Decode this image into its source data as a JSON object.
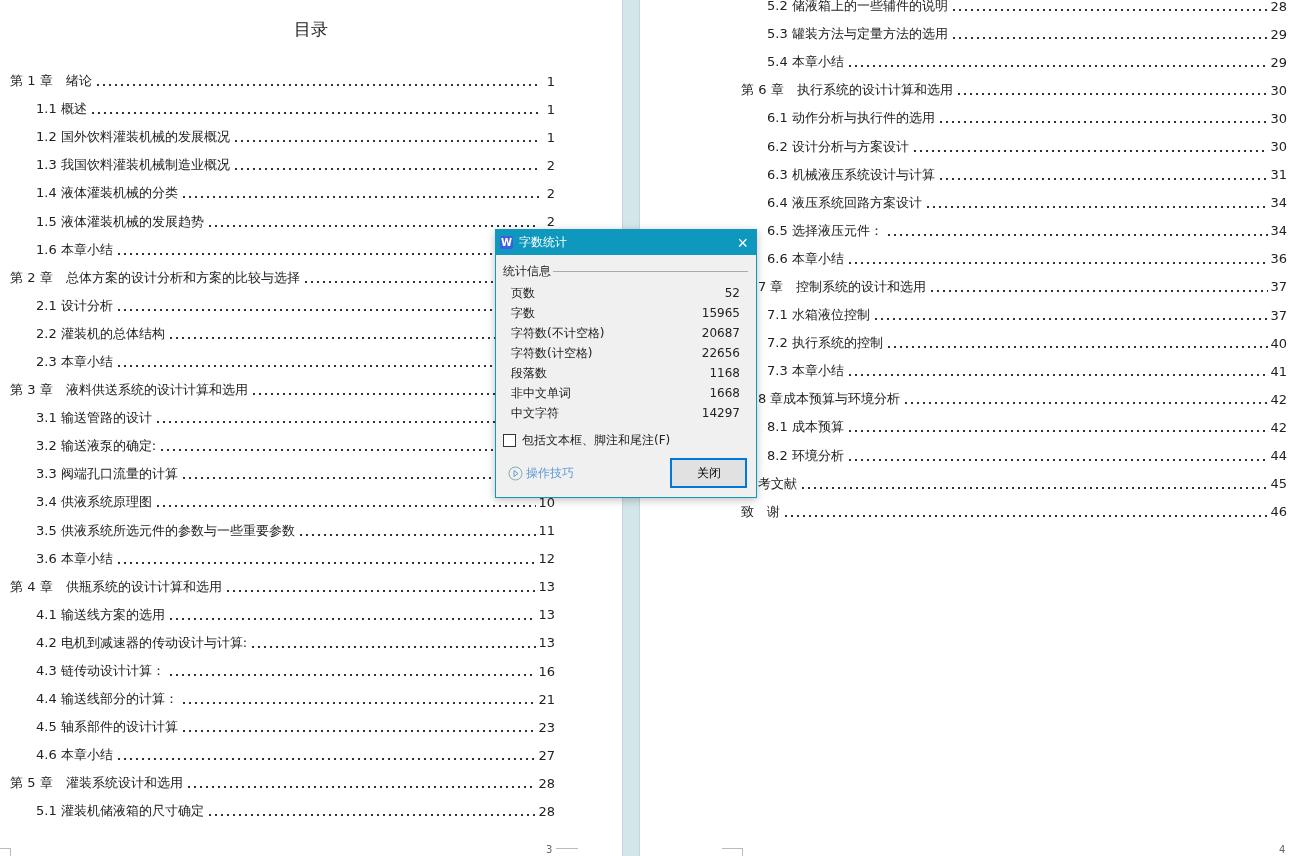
{
  "left_page": {
    "title": "目录",
    "entries": [
      {
        "kind": "chapter",
        "text": "第 1 章　绪论",
        "page": "1"
      },
      {
        "kind": "section",
        "text": "1.1 概述",
        "page": "1"
      },
      {
        "kind": "section",
        "text": "1.2 国外饮料灌装机械的发展概况",
        "page": "1"
      },
      {
        "kind": "section",
        "text": "1.3 我国饮料灌装机械制造业概况",
        "page": "2"
      },
      {
        "kind": "section",
        "text": "1.4 液体灌装机械的分类",
        "page": "2"
      },
      {
        "kind": "section",
        "text": "1.5 液体灌装机械的发展趋势",
        "page": "2"
      },
      {
        "kind": "section",
        "text": "1.6 本章小结"
      },
      {
        "kind": "chapter",
        "text": "第 2 章　总体方案的设计分析和方案的比较与选择"
      },
      {
        "kind": "section",
        "text": "2.1 设计分析"
      },
      {
        "kind": "section",
        "text": "2.2 灌装机的总体结构"
      },
      {
        "kind": "section",
        "text": "2.3 本章小结"
      },
      {
        "kind": "chapter",
        "text": "第 3 章　液料供送系统的设计计算和选用"
      },
      {
        "kind": "section",
        "text": "3.1 输送管路的设计"
      },
      {
        "kind": "section",
        "text": "3.2 输送液泵的确定:"
      },
      {
        "kind": "section",
        "text": "3.3 阀端孔口流量的计算"
      },
      {
        "kind": "section",
        "text": "3.4 供液系统原理图",
        "page": "10"
      },
      {
        "kind": "section",
        "text": "3.5 供液系统所选元件的参数与一些重要参数",
        "page": "11"
      },
      {
        "kind": "section",
        "text": "3.6 本章小结",
        "page": "12"
      },
      {
        "kind": "chapter",
        "text": "第 4 章　供瓶系统的设计计算和选用",
        "page": "13"
      },
      {
        "kind": "section",
        "text": "4.1 输送线方案的选用",
        "page": "13"
      },
      {
        "kind": "section",
        "text": "4.2 电机到减速器的传动设计与计算:",
        "page": "13"
      },
      {
        "kind": "section",
        "text": "4.3 链传动设计计算：",
        "page": "16"
      },
      {
        "kind": "section",
        "text": "4.4 输送线部分的计算：",
        "page": "21"
      },
      {
        "kind": "section",
        "text": "4.5 轴系部件的设计计算",
        "page": "23"
      },
      {
        "kind": "section",
        "text": "4.6 本章小结",
        "page": "27"
      },
      {
        "kind": "chapter",
        "text": "第 5 章　灌装系统设计和选用",
        "page": "28"
      },
      {
        "kind": "section",
        "text": "5.1 灌装机储液箱的尺寸确定",
        "page": "28"
      }
    ],
    "page_number": "3"
  },
  "right_page": {
    "entries": [
      {
        "kind": "section",
        "text": "5.2 储液箱上的一些辅件的说明",
        "page": "28"
      },
      {
        "kind": "section",
        "text": "5.3 罐装方法与定量方法的选用",
        "page": "29"
      },
      {
        "kind": "section",
        "text": "5.4 本章小结",
        "page": "29"
      },
      {
        "kind": "chapter",
        "text": "第 6 章　执行系统的设计计算和选用",
        "page": "30"
      },
      {
        "kind": "section",
        "text": "6.1 动作分析与执行件的选用",
        "page": "30"
      },
      {
        "kind": "section",
        "text": "6.2 设计分析与方案设计",
        "page": "30"
      },
      {
        "kind": "section",
        "text": "6.3 机械液压系统设计与计算",
        "page": "31"
      },
      {
        "kind": "section",
        "text": "6.4 液压系统回路方案设计",
        "page": "34"
      },
      {
        "kind": "section",
        "text": "6.5 选择液压元件：",
        "page": "34"
      },
      {
        "kind": "section",
        "text": "6.6 本章小结",
        "page": "36"
      },
      {
        "kind": "cut",
        "text": "7 章　控制系统的设计和选用",
        "page": "37"
      },
      {
        "kind": "section",
        "text": "7.1 水箱液位控制",
        "page": "37"
      },
      {
        "kind": "section",
        "text": "7.2 执行系统的控制",
        "page": "40"
      },
      {
        "kind": "section",
        "text": "7.3 本章小结",
        "page": "41"
      },
      {
        "kind": "cut",
        "text": "8 章成本预算与环境分析",
        "page": "42"
      },
      {
        "kind": "section",
        "text": "8.1  成本预算",
        "page": "42"
      },
      {
        "kind": "section",
        "text": "8.2 环境分析",
        "page": "44"
      },
      {
        "kind": "cut",
        "text": "考文献",
        "page": "45"
      },
      {
        "kind": "chapter",
        "text": "致　谢",
        "page": "46"
      }
    ],
    "page_number": "4"
  },
  "dialog": {
    "icon_letter": "W",
    "title": "字数统计",
    "close": "×",
    "group": "统计信息",
    "stats": [
      {
        "label": "页数",
        "value": "52"
      },
      {
        "label": "字数",
        "value": "15965"
      },
      {
        "label": "字符数(不计空格)",
        "value": "20687"
      },
      {
        "label": "字符数(计空格)",
        "value": "22656"
      },
      {
        "label": "段落数",
        "value": "1168"
      },
      {
        "label": "非中文单词",
        "value": "1668"
      },
      {
        "label": "中文字符",
        "value": "14297"
      }
    ],
    "checkbox": {
      "label": "包括文本框、脚注和尾注(F)",
      "checked": false
    },
    "tips_link": "操作技巧",
    "button": "关闭"
  }
}
